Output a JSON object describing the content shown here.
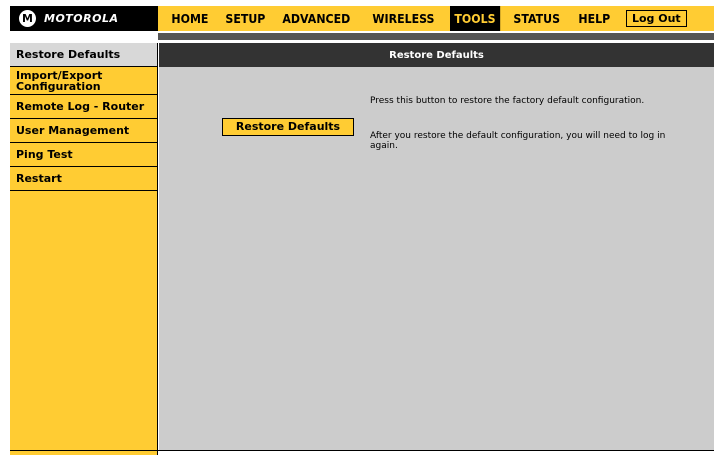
{
  "brand": {
    "logo_text": "MOTOROLA",
    "logo_mark": "M"
  },
  "nav": {
    "items": [
      "HOME",
      "SETUP",
      "ADVANCED",
      "WIRELESS",
      "TOOLS",
      "STATUS",
      "HELP"
    ],
    "active": "TOOLS",
    "logout_label": "Log Out"
  },
  "sidebar": {
    "items": [
      {
        "label": "Restore Defaults",
        "active": true
      },
      {
        "label": "Import/Export Configuration",
        "active": false
      },
      {
        "label": "Remote Log - Router",
        "active": false
      },
      {
        "label": "User Management",
        "active": false
      },
      {
        "label": "Ping Test",
        "active": false
      },
      {
        "label": "Restart",
        "active": false
      }
    ]
  },
  "main": {
    "header": "Restore Defaults",
    "button_label": "Restore Defaults",
    "desc1": "Press this button to restore the factory default configuration.",
    "desc2": "After you restore the default configuration, you will need to log in again."
  },
  "colors": {
    "accent": "#ffcc33",
    "header_bg": "#333333",
    "panel_bg": "#cccccc",
    "active_sidebar": "#d8d8d8"
  }
}
